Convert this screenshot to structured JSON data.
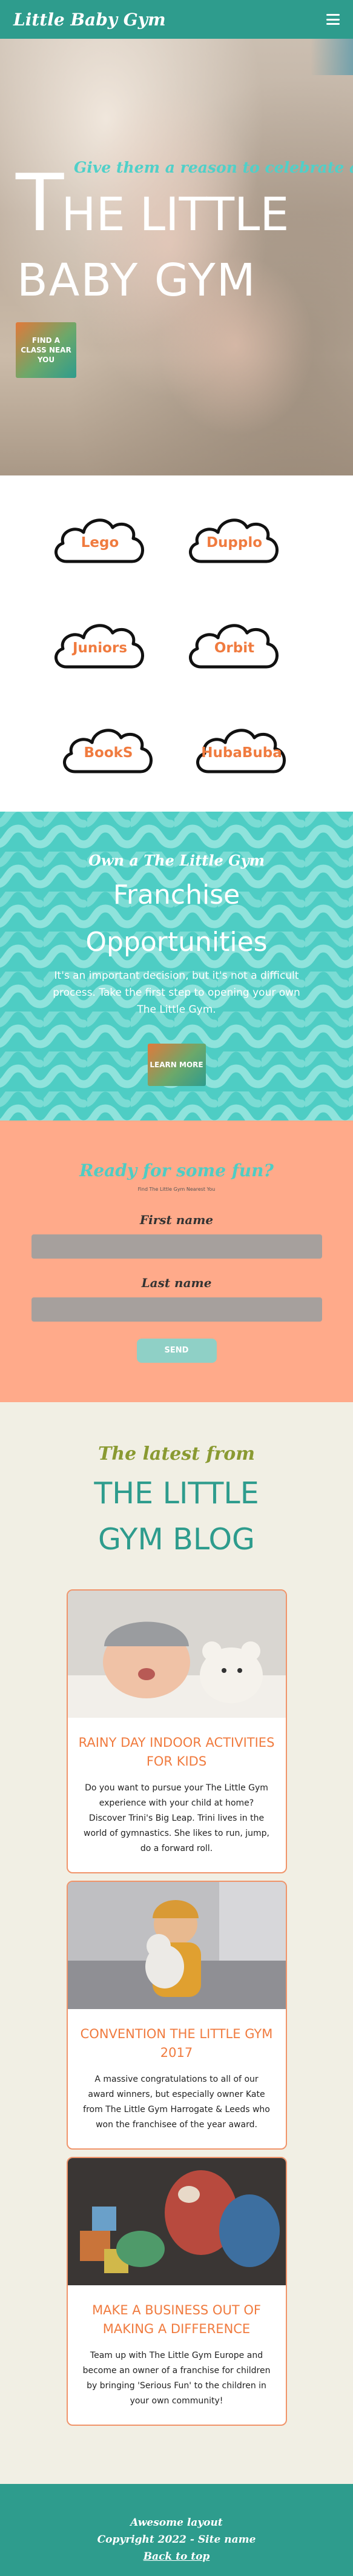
{
  "header": {
    "brand": "Little Baby Gym",
    "menu_icon": "hamburger-menu-icon"
  },
  "hero": {
    "tagline": "Give them a reason to celebrate at",
    "title_initial": "T",
    "title_rest": "HE LITTLE",
    "title_line2": "BABY GYM",
    "cta": "FIND A CLASS NEAR YOU"
  },
  "classes": [
    "Lego",
    "Dupplo",
    "Juniors",
    "Orbit",
    "BookS",
    "HubaBuba"
  ],
  "franchise": {
    "kicker": "Own a The Little Gym",
    "title_line1": "Franchise",
    "title_line2": "Opportunities",
    "body": "It's an important decision, but it's not a difficult process. Take the first step to opening your own The Little Gym.",
    "button": "LEARN MORE"
  },
  "signup": {
    "title": "Ready for some fun?",
    "subtitle": "Find The Little Gym Nearest You",
    "first_name_label": "First name",
    "last_name_label": "Last name",
    "send": "SEND"
  },
  "blog": {
    "kicker": "The latest from",
    "title_line1": "THE LITTLE",
    "title_line2": "GYM BLOG",
    "posts": [
      {
        "title": "RAINY DAY INDOOR ACTIVITIES FOR KIDS",
        "text": "Do you want to pursue your The Little Gym experience with your child at home? Discover Trini's Big Leap. Trini lives in the world of gymnastics. She likes to run, jump, do a forward roll."
      },
      {
        "title": "CONVENTION THE LITTLE GYM 2017",
        "text": "A massive congratulations to all of our award winners, but especially owner Kate from The Little Gym Harrogate & Leeds who won the franchisee of the year award."
      },
      {
        "title": "MAKE A BUSINESS OUT OF MAKING A DIFFERENCE",
        "text": "Team up with The Little Gym Europe and become an owner of a franchise for children by bringing 'Serious Fun' to the children in your own community!"
      }
    ]
  },
  "footer": {
    "line1": "Awesome layout",
    "line2": "Copyright 2022 - Site name",
    "back_to_top": "Back to top"
  }
}
